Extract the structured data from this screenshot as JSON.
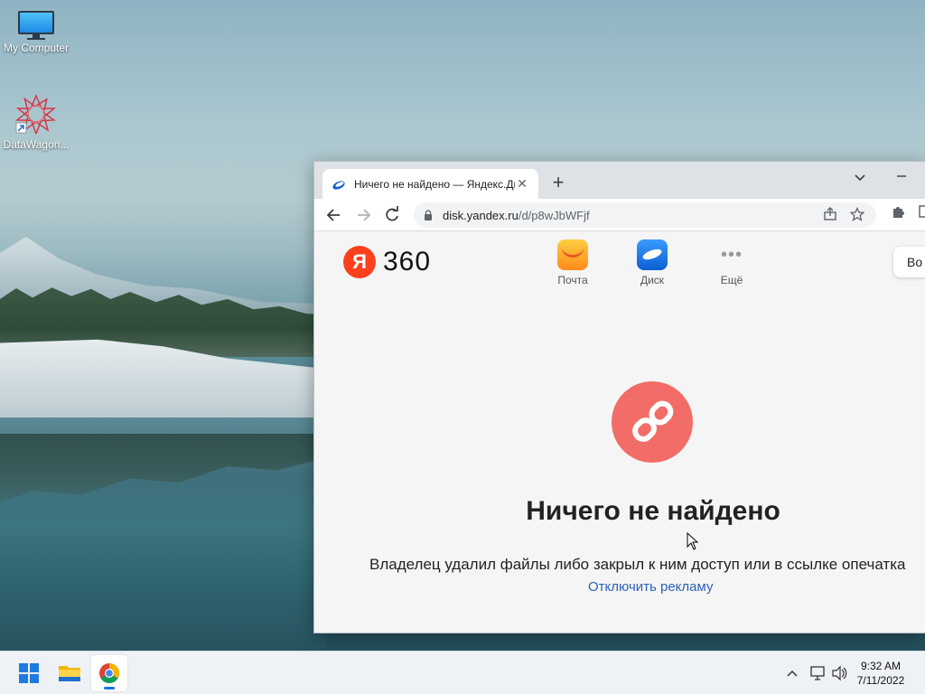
{
  "desktop": {
    "icons": [
      {
        "label": "My Computer",
        "icon": "computer-icon"
      },
      {
        "label": "DataWagon...",
        "icon": "datawagon-icon"
      }
    ]
  },
  "browser": {
    "tab": {
      "title": "Ничего не найдено — Яндекс.Диск",
      "favicon": "yandex-disk-icon"
    },
    "new_tab_label": "+",
    "address": {
      "host": "disk.yandex.ru",
      "path": "/d/p8wJbWFjf"
    },
    "page": {
      "logo_letter": "Я",
      "logo_text": "360",
      "services": [
        {
          "label": "Почта",
          "icon": "mail-icon"
        },
        {
          "label": "Диск",
          "icon": "disk-icon"
        },
        {
          "label": "Ещё",
          "icon": "more-icon"
        }
      ],
      "login_label": "Во",
      "error_title": "Ничего не найдено",
      "error_desc": "Владелец удалил файлы либо закрыл к ним доступ или в ссылке опечатка",
      "ads_link": "Отключить рекламу"
    },
    "colors": {
      "accent": "#fc3f1d",
      "error_circle": "#f26d67",
      "link": "#2d62ba"
    }
  },
  "taskbar": {
    "time": "9:32 AM",
    "date": "7/11/2022"
  }
}
